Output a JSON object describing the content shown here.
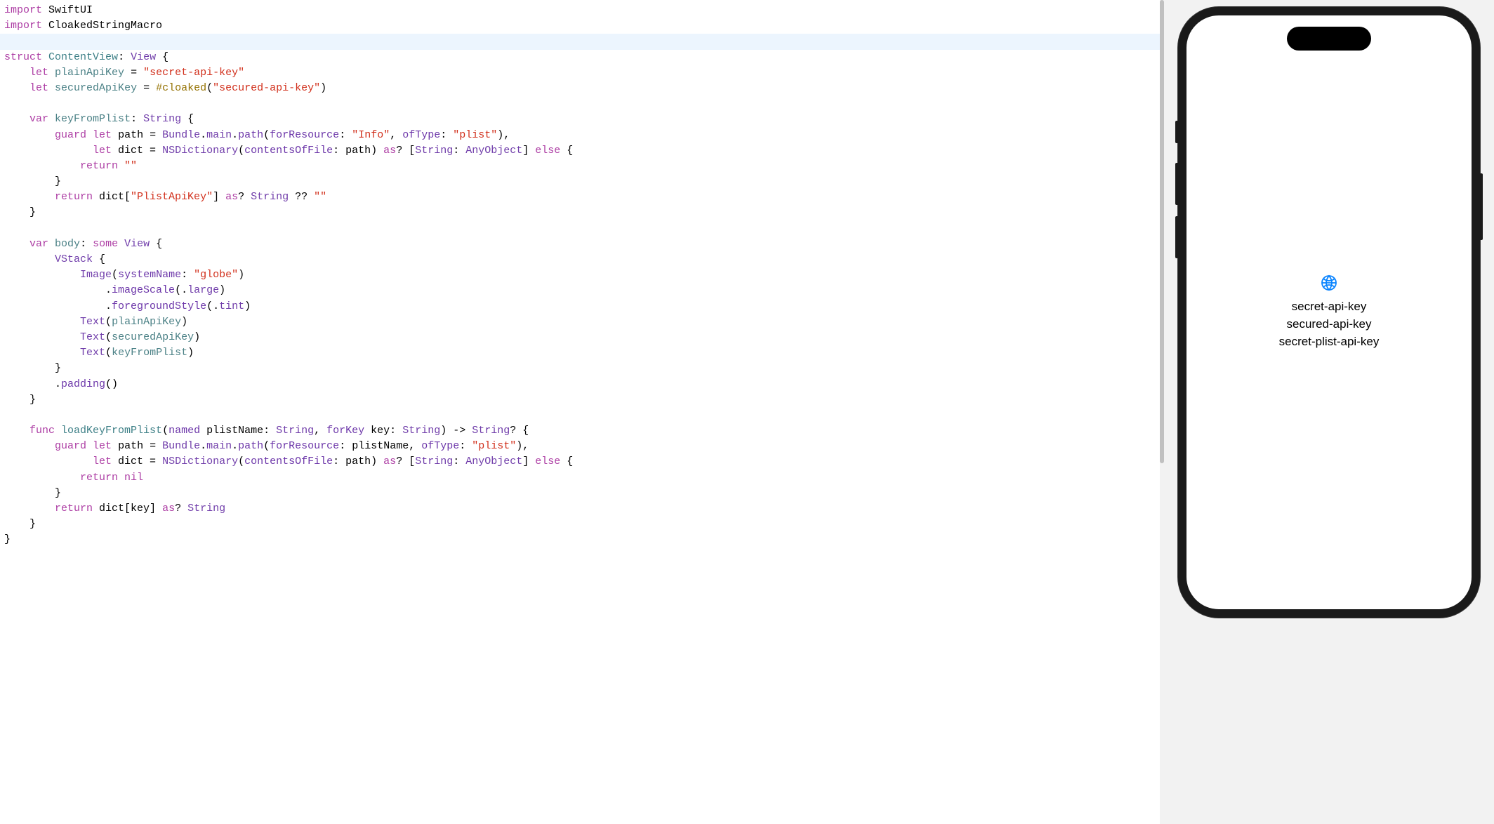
{
  "code": {
    "l1": {
      "kw": "import",
      "mod": "SwiftUI"
    },
    "l2": {
      "kw": "import",
      "mod": "CloakedStringMacro"
    },
    "l4": {
      "kw1": "struct",
      "name": "ContentView",
      "colon": ":",
      "proto": "View",
      "brace": " {"
    },
    "l5": {
      "indent": "    ",
      "kw": "let",
      "prop": "plainApiKey",
      "eq": " = ",
      "str": "\"secret-api-key\""
    },
    "l6": {
      "indent": "    ",
      "kw": "let",
      "prop": "securedApiKey",
      "eq": " = ",
      "macro": "#cloaked",
      "open": "(",
      "str": "\"secured-api-key\"",
      "close": ")"
    },
    "l8": {
      "indent": "    ",
      "kw": "var",
      "prop": "keyFromPlist",
      "colon": ": ",
      "type": "String",
      "brace": " {"
    },
    "l9": {
      "indent": "        ",
      "kw1": "guard",
      "kw2": "let",
      "var": " path = ",
      "type1": "Bundle",
      "dot1": ".",
      "main": "main",
      "dot2": ".",
      "fn": "path",
      "open": "(",
      "arg1": "forResource",
      "col1": ": ",
      "str1": "\"Info\"",
      "comma": ", ",
      "arg2": "ofType",
      "col2": ": ",
      "str2": "\"plist\"",
      "close": "),"
    },
    "l10": {
      "indent": "              ",
      "kw": "let",
      "var": " dict = ",
      "type1": "NSDictionary",
      "open": "(",
      "arg": "contentsOfFile",
      "col": ": ",
      "path": "path) ",
      "as": "as",
      "q": "? [",
      "str": "String",
      "col2": ": ",
      "ao": "AnyObject",
      "close": "] ",
      "else": "else",
      "brace": " {"
    },
    "l11": {
      "indent": "            ",
      "kw": "return",
      "str": " \"\""
    },
    "l12": {
      "indent": "        ",
      "brace": "}"
    },
    "l13": {
      "indent": "        ",
      "kw": "return",
      "dict": " dict[",
      "str1": "\"PlistApiKey\"",
      "close": "] ",
      "as": "as",
      "q": "? ",
      "type": "String",
      "coal": " ?? ",
      "str2": "\"\""
    },
    "l14": {
      "indent": "    ",
      "brace": "}"
    },
    "l16": {
      "indent": "    ",
      "kw": "var",
      "prop": "body",
      "colon": ": ",
      "some": "some",
      "view": " View",
      "brace": " {"
    },
    "l17": {
      "indent": "        ",
      "type": "VStack",
      "brace": " {"
    },
    "l18": {
      "indent": "            ",
      "type": "Image",
      "open": "(",
      "arg": "systemName",
      "col": ": ",
      "str": "\"globe\"",
      "close": ")"
    },
    "l19": {
      "indent": "                ",
      "dot": ".",
      "fn": "imageScale",
      "open": "(.",
      "val": "large",
      "close": ")"
    },
    "l20": {
      "indent": "                ",
      "dot": ".",
      "fn": "foregroundStyle",
      "open": "(.",
      "val": "tint",
      "close": ")"
    },
    "l21": {
      "indent": "            ",
      "type": "Text",
      "open": "(",
      "prop": "plainApiKey",
      "close": ")"
    },
    "l22": {
      "indent": "            ",
      "type": "Text",
      "open": "(",
      "prop": "securedApiKey",
      "close": ")"
    },
    "l23": {
      "indent": "            ",
      "type": "Text",
      "open": "(",
      "prop": "keyFromPlist",
      "close": ")"
    },
    "l24": {
      "indent": "        ",
      "brace": "}"
    },
    "l25": {
      "indent": "        ",
      "dot": ".",
      "fn": "padding",
      "parens": "()"
    },
    "l26": {
      "indent": "    ",
      "brace": "}"
    },
    "l28": {
      "indent": "    ",
      "kw": "func",
      "fn": " loadKeyFromPlist",
      "open": "(",
      "arg1": "named",
      "p1": " plistName: ",
      "t1": "String",
      "comma": ", ",
      "arg2": "forKey",
      "p2": " key: ",
      "t2": "String",
      "close": ") -> ",
      "ret": "String",
      "opt": "? {"
    },
    "l29": {
      "indent": "        ",
      "kw1": "guard",
      "kw2": "let",
      "var": " path = ",
      "type1": "Bundle",
      "dot1": ".",
      "main": "main",
      "dot2": ".",
      "fn": "path",
      "open": "(",
      "arg1": "forResource",
      "col1": ": plistName, ",
      "arg2": "ofType",
      "col2": ": ",
      "str": "\"plist\"",
      "close": "),"
    },
    "l30": {
      "indent": "              ",
      "kw": "let",
      "var": " dict = ",
      "type1": "NSDictionary",
      "open": "(",
      "arg": "contentsOfFile",
      "col": ": ",
      "path": "path) ",
      "as": "as",
      "q": "? [",
      "str": "String",
      "col2": ": ",
      "ao": "AnyObject",
      "close": "] ",
      "else": "else",
      "brace": " {"
    },
    "l31": {
      "indent": "            ",
      "kw": "return",
      "nil": " nil"
    },
    "l32": {
      "indent": "        ",
      "brace": "}"
    },
    "l33": {
      "indent": "        ",
      "kw": "return",
      "dict": " dict[key] ",
      "as": "as",
      "q": "? ",
      "type": "String"
    },
    "l34": {
      "indent": "    ",
      "brace": "}"
    },
    "l35": {
      "brace": "}"
    }
  },
  "preview": {
    "text1": "secret-api-key",
    "text2": "secured-api-key",
    "text3": "secret-plist-api-key"
  }
}
